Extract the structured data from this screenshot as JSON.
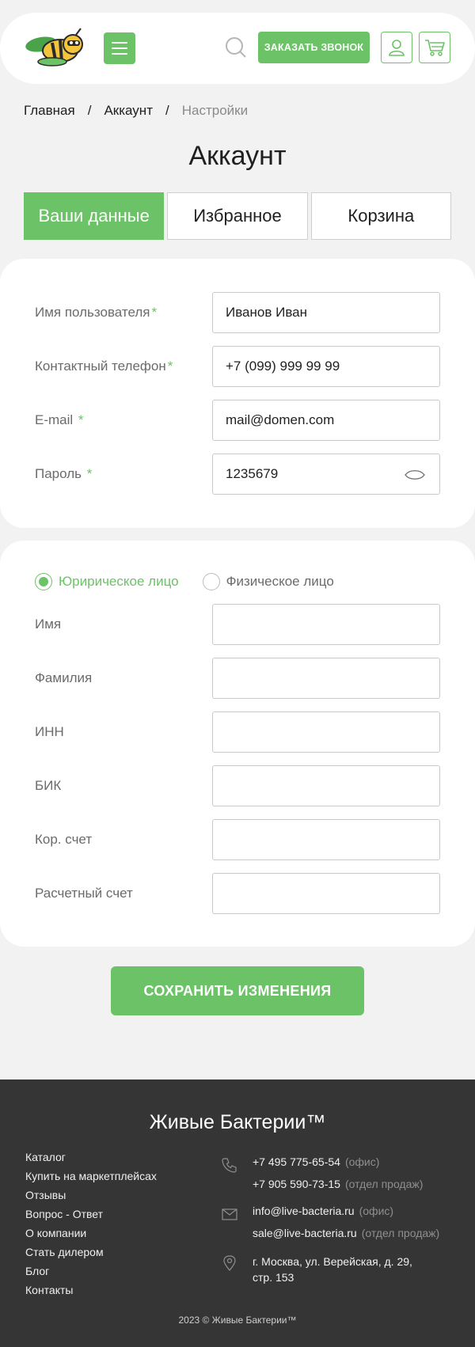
{
  "header": {
    "call_label": "ЗАКАЗАТЬ ЗВОНОК",
    "icons": [
      "logo-bee",
      "menu-icon",
      "search-icon",
      "user-icon",
      "cart-icon"
    ]
  },
  "breadcrumb": {
    "items": [
      "Главная",
      "Аккаунт",
      "Настройки"
    ],
    "separator": "/"
  },
  "page_title": "Аккаунт",
  "tabs": [
    {
      "label": "Ваши данные",
      "active": true
    },
    {
      "label": "Избранное",
      "active": false
    },
    {
      "label": "Корзина",
      "active": false
    }
  ],
  "account_form": {
    "fields": [
      {
        "label": "Имя пользователя",
        "required": "*",
        "value": "Иванов Иван"
      },
      {
        "label": "Контактный телефон",
        "required": "*",
        "value": "+7 (099) 999 99 99"
      },
      {
        "label": "E-mail ",
        "required": "*",
        "value": "mail@domen.com"
      },
      {
        "label": "Пароль ",
        "required": "*",
        "value": "1235679"
      }
    ]
  },
  "legal_form": {
    "radios": [
      {
        "label": "Юририческое лицо",
        "checked": true
      },
      {
        "label": "Физическое лицо",
        "checked": false
      }
    ],
    "fields": [
      {
        "label": "Имя",
        "value": ""
      },
      {
        "label": "Фамилия",
        "value": ""
      },
      {
        "label": "ИНН",
        "value": ""
      },
      {
        "label": "БИК",
        "value": ""
      },
      {
        "label": "Кор. счет",
        "value": ""
      },
      {
        "label": "Расчетный счет",
        "value": ""
      }
    ]
  },
  "save_label": "СОХРАНИТЬ ИЗМЕНЕНИЯ",
  "footer": {
    "brand": "Живые Бактерии™",
    "links": [
      "Каталог",
      "Купить на маркетплейсах",
      "Отзывы",
      "Вопрос - Ответ",
      "О компании",
      "Стать дилером",
      "Блог",
      "Контакты"
    ],
    "phones": [
      {
        "value": "+7 495 775-65-54",
        "note": "(офис)"
      },
      {
        "value": "+7 905 590-73-15",
        "note": "(отдел продаж)"
      }
    ],
    "emails": [
      {
        "value": "info@live-bacteria.ru",
        "note": "(офис)"
      },
      {
        "value": "sale@live-bacteria.ru",
        "note": "(отдел продаж)"
      }
    ],
    "address": "г. Москва, ул. Верейская, д. 29, стр. 153",
    "copyright": "2023 © Живые Бактерии™"
  },
  "colors": {
    "accent": "#6cc266",
    "background": "#f2f2f2",
    "footer_bg": "#353535"
  }
}
